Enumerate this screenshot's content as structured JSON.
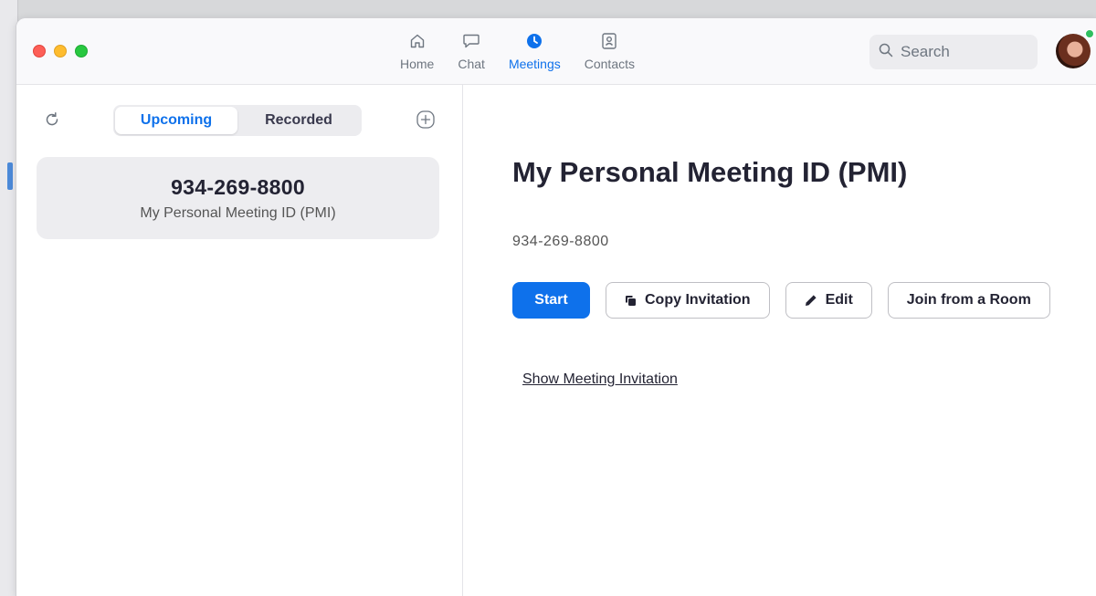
{
  "nav": {
    "items": [
      {
        "label": "Home",
        "icon": "home-icon",
        "active": false
      },
      {
        "label": "Chat",
        "icon": "chat-icon",
        "active": false
      },
      {
        "label": "Meetings",
        "icon": "clock-icon",
        "active": true
      },
      {
        "label": "Contacts",
        "icon": "contacts-icon",
        "active": false
      }
    ]
  },
  "search": {
    "placeholder": "Search"
  },
  "sidebar": {
    "tabs": [
      {
        "label": "Upcoming",
        "active": true
      },
      {
        "label": "Recorded",
        "active": false
      }
    ],
    "meeting": {
      "number": "934-269-8800",
      "name": "My Personal Meeting ID (PMI)"
    }
  },
  "detail": {
    "title": "My Personal Meeting ID (PMI)",
    "meeting_id": "934-269-8800",
    "buttons": {
      "start": "Start",
      "copy": "Copy Invitation",
      "edit": "Edit",
      "join_room": "Join from a Room"
    },
    "show_invitation": "Show Meeting Invitation"
  },
  "colors": {
    "accent": "#0e71eb",
    "presence": "#2fbf5f",
    "close": "#fd5f57",
    "minimize": "#febc2e",
    "maximize": "#28c840"
  }
}
